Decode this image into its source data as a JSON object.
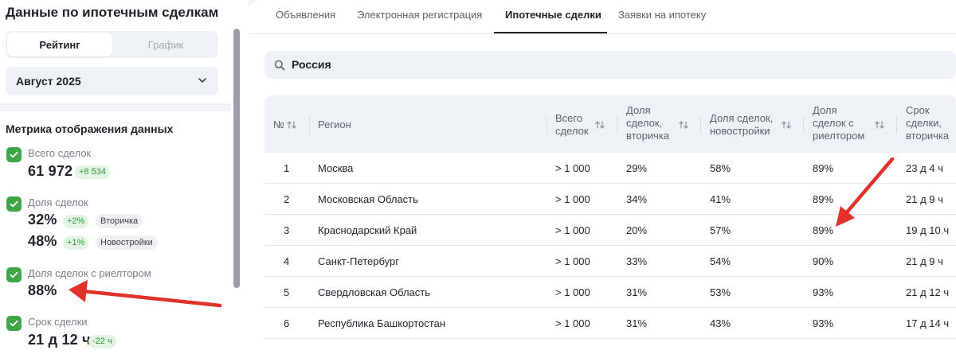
{
  "left_panel": {
    "title": "Данные по ипотечным сделкам",
    "segments": {
      "active": "Рейтинг",
      "inactive": "График"
    },
    "month": "Август 2025",
    "metrics_title": "Метрика отображения данных",
    "metrics": [
      {
        "label": "Всего сделок",
        "value": "61 972",
        "delta": "+8 534"
      },
      {
        "label": "Доля сделок",
        "value1": "32%",
        "delta1": "+2%",
        "tag1": "Вторичка",
        "value2": "48%",
        "delta2": "+1%",
        "tag2": "Новостройки"
      },
      {
        "label": "Доля сделок с риелтором",
        "value": "88%"
      },
      {
        "label": "Срок сделки",
        "value": "21 д 12 ч",
        "delta": "-22 ч"
      }
    ]
  },
  "tabs": [
    "Объявления",
    "Электронная регистрация",
    "Ипотечные сделки",
    "Заявки на ипотеку"
  ],
  "active_tab": "Ипотечные сделки",
  "search": {
    "value": "Россия"
  },
  "table": {
    "headers": {
      "num": "№",
      "region": "Регион",
      "total": [
        "Всего",
        "сделок"
      ],
      "secondary": [
        "Доля",
        "сделок,",
        "вторичка"
      ],
      "newbuild": [
        "Доля сделок,",
        "новостройки"
      ],
      "realtor": [
        "Доля",
        "сделок с",
        "риелтором"
      ],
      "term": [
        "Срок",
        "сделки,",
        "вторичка"
      ]
    },
    "rows": [
      {
        "num": "1",
        "region": "Москва",
        "total": "> 1 000",
        "secondary": "29%",
        "newbuild": "58%",
        "realtor": "89%",
        "term": "23 д 4 ч"
      },
      {
        "num": "2",
        "region": "Московская Область",
        "total": "> 1 000",
        "secondary": "34%",
        "newbuild": "41%",
        "realtor": "89%",
        "term": "21 д 9 ч"
      },
      {
        "num": "3",
        "region": "Краснодарский Край",
        "total": "> 1 000",
        "secondary": "20%",
        "newbuild": "57%",
        "realtor": "89%",
        "term": "19 д 10 ч"
      },
      {
        "num": "4",
        "region": "Санкт-Петербург",
        "total": "> 1 000",
        "secondary": "33%",
        "newbuild": "54%",
        "realtor": "90%",
        "term": "21 д 9 ч"
      },
      {
        "num": "5",
        "region": "Свердловская Область",
        "total": "> 1 000",
        "secondary": "31%",
        "newbuild": "53%",
        "realtor": "93%",
        "term": "21 д 12 ч"
      },
      {
        "num": "6",
        "region": "Республика Башкортостан",
        "total": "> 1 000",
        "secondary": "31%",
        "newbuild": "43%",
        "realtor": "93%",
        "term": "17 д 14 ч"
      }
    ]
  },
  "colors": {
    "accent_green": "#3fa64a",
    "annotation_red": "#e0322b",
    "tab_active": "#1f2229",
    "panel_bg": "#eef1f6"
  },
  "icons": {
    "checkbox": "check-icon",
    "dropdown": "chevron-down-icon",
    "search": "search-icon",
    "sort": "sort-arrows-icon"
  }
}
